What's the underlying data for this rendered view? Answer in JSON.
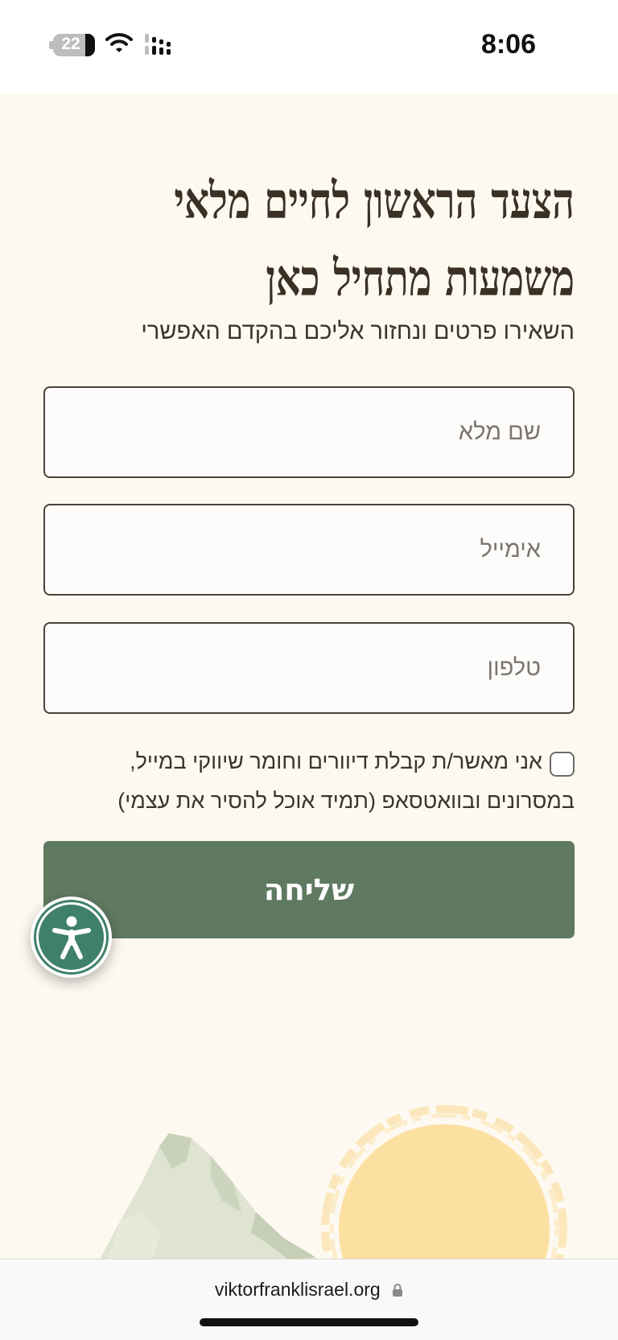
{
  "status_bar": {
    "time": "8:06",
    "battery_level": "22",
    "icons": [
      "battery-icon",
      "wifi-icon",
      "signal-icon"
    ]
  },
  "page": {
    "headline_line1": "הצעד הראשון לחיים מלאי",
    "headline_line2": "משמעות מתחיל כאן",
    "subtitle": "השאירו פרטים ונחזור אליכם בהקדם האפשרי"
  },
  "form": {
    "name_placeholder": "שם מלא",
    "name_value": "",
    "email_placeholder": "אימייל",
    "email_value": "",
    "phone_placeholder": "טלפון",
    "phone_value": "",
    "consent_label": "אני מאשר/ת קבלת דיוורים וחומר שיווקי במייל, במסרונים ובוואטסאפ (תמיד אוכל להסיר את עצמי)",
    "consent_checked": false,
    "submit_label": "שליחה"
  },
  "accessibility": {
    "icon": "accessibility-icon"
  },
  "browser": {
    "url": "viktorfranklisrael.org",
    "lock_icon": "lock-icon"
  },
  "colors": {
    "background": "#fdf9f0",
    "text": "#3d3428",
    "button": "#5f7a60",
    "accessibility": "#3f8168",
    "sun": "#fce0a2",
    "mountain": "#dfe3d1"
  }
}
